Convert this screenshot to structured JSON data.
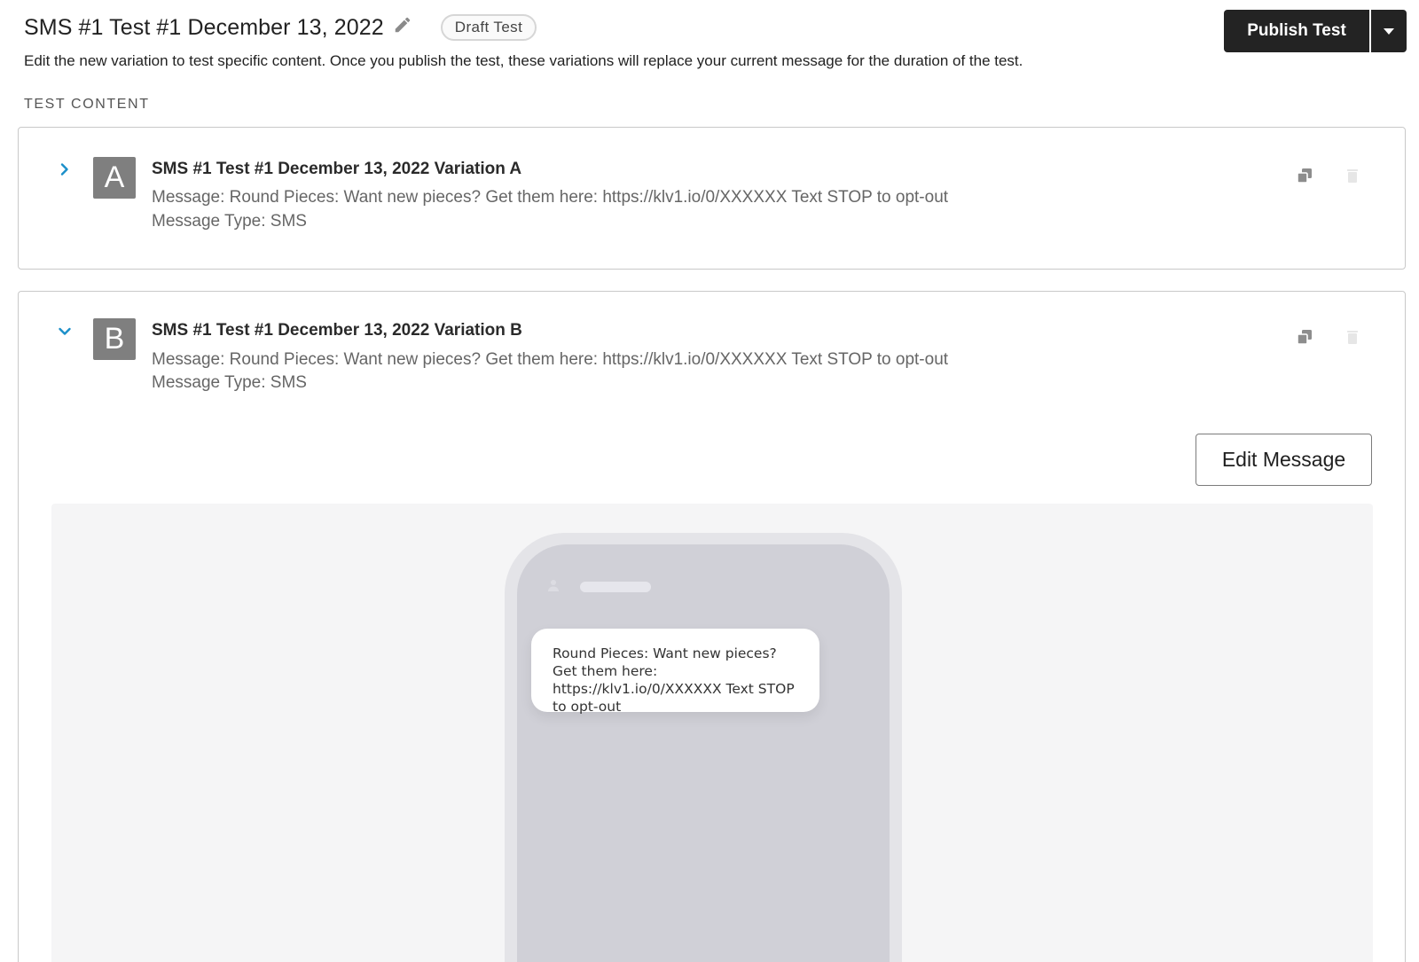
{
  "header": {
    "title": "SMS #1 Test #1 December 13, 2022",
    "status_badge": "Draft Test",
    "subtitle": "Edit the new variation to test specific content. Once you publish the test, these variations will replace your current message for the duration of the test.",
    "publish_label": "Publish Test"
  },
  "section_label": "TEST CONTENT",
  "variations": [
    {
      "letter": "A",
      "name": "SMS #1 Test #1 December 13, 2022 Variation A",
      "message": "Message: Round Pieces: Want new pieces? Get them here: https://klv1.io/0/XXXXXX Text STOP to opt-out",
      "type": "Message Type: SMS",
      "expanded": false
    },
    {
      "letter": "B",
      "name": "SMS #1 Test #1 December 13, 2022 Variation B",
      "message": "Message: Round Pieces: Want new pieces? Get them here: https://klv1.io/0/XXXXXX Text STOP to opt-out",
      "type": "Message Type: SMS",
      "expanded": true,
      "edit_label": "Edit Message",
      "preview_text": "Round Pieces: Want new pieces? Get them here: https://klv1.io/0/XXXXXX Text STOP to opt-out"
    }
  ],
  "icons": {
    "edit_title": "pencil-icon",
    "dropdown": "caret-down-icon",
    "collapsed": "chevron-right-icon",
    "expanded": "chevron-down-icon",
    "duplicate": "duplicate-icon",
    "delete": "trash-icon"
  },
  "colors": {
    "accent": "#1b8fc9",
    "primary_button": "#232323",
    "avatar": "#7f7f7f",
    "preview_bg": "#f5f5f6"
  }
}
